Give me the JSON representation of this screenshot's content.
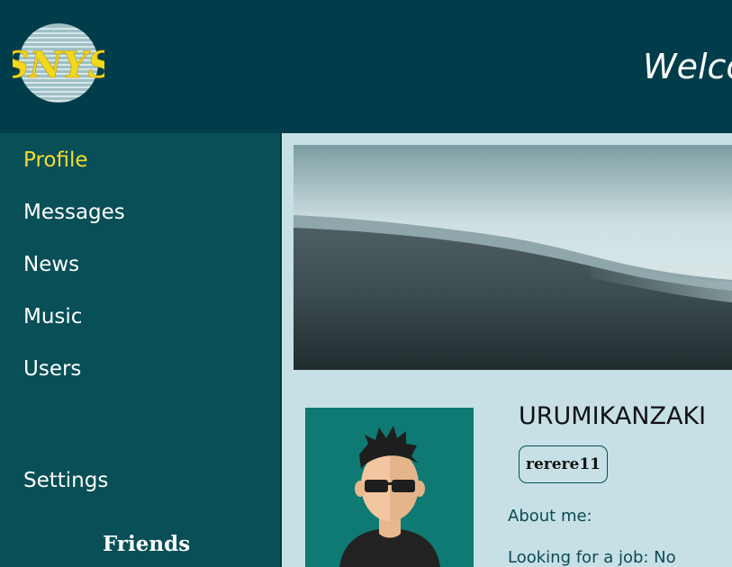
{
  "header": {
    "logo_text": "SNYS",
    "welcome_text": "Welco"
  },
  "sidebar": {
    "items": [
      {
        "label": "Profile",
        "active": true
      },
      {
        "label": "Messages",
        "active": false
      },
      {
        "label": "News",
        "active": false
      },
      {
        "label": "Music",
        "active": false
      },
      {
        "label": "Users",
        "active": false
      }
    ],
    "settings_label": "Settings",
    "friends_title": "Friends"
  },
  "profile": {
    "username": "URUMIKANZAKI",
    "status": "rerere11",
    "about_label": "About me:",
    "job_label": "Looking for a job: No"
  },
  "colors": {
    "header_bg": "#003d4a",
    "sidebar_bg": "#084f57",
    "content_bg": "#c6e0e6",
    "active_nav": "#f7dc2e",
    "avatar_bg": "#0e7a73"
  }
}
